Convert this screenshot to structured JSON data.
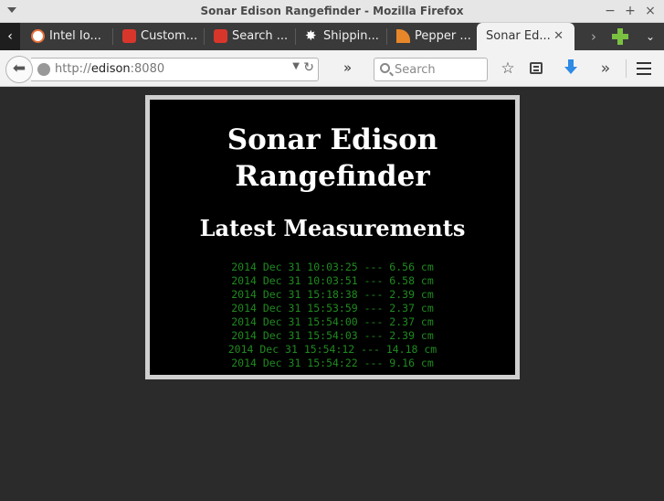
{
  "window": {
    "title": "Sonar Edison Rangefinder - Mozilla Firefox",
    "controls": {
      "minimize": "−",
      "maximize": "+",
      "close": "×"
    }
  },
  "tabs": [
    {
      "label": "Intel Io...",
      "icon": "intel-iot-favicon",
      "color": "#e8703a"
    },
    {
      "label": "Custom...",
      "icon": "custom-favicon",
      "color": "#d9362b"
    },
    {
      "label": "Search ...",
      "icon": "search-favicon",
      "color": "#d9362b"
    },
    {
      "label": "Shippin...",
      "icon": "star-favicon",
      "color": "#ffffff"
    },
    {
      "label": "Pepper ...",
      "icon": "rss-favicon",
      "color": "#e8872a"
    },
    {
      "label": "Sonar Ed...",
      "active": true
    }
  ],
  "navbar": {
    "url_scheme": "http://",
    "url_host": "edison",
    "url_port": ":8080",
    "search_placeholder": "Search",
    "overflow": "»"
  },
  "page": {
    "title": "Sonar Edison Rangefinder",
    "subtitle": "Latest Measurements",
    "measurements": [
      "2014 Dec 31 10:03:25 --- 6.56 cm",
      "2014 Dec 31 10:03:51 --- 6.58 cm",
      "2014 Dec 31 15:18:38 --- 2.39 cm",
      "2014 Dec 31 15:53:59 --- 2.37 cm",
      "2014 Dec 31 15:54:00 --- 2.37 cm",
      "2014 Dec 31 15:54:03 --- 2.39 cm",
      "2014 Dec 31 15:54:12 --- 14.18 cm",
      "2014 Dec 31 15:54:22 --- 9.16 cm"
    ]
  }
}
